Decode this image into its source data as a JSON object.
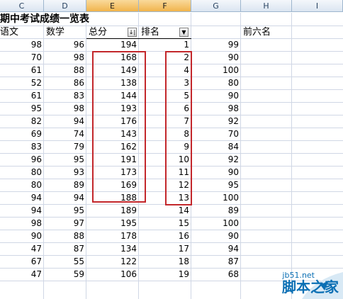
{
  "columns": [
    "C",
    "D",
    "E",
    "F",
    "G",
    "H",
    "I"
  ],
  "title": "期中考试成绩一览表",
  "headers": {
    "chinese": "语文",
    "math": "数学",
    "total": "总分",
    "rank": "排名",
    "top6": "前六名",
    "sort_indicator": "↓|",
    "dropdown_arrow": "▼"
  },
  "rows": [
    {
      "c": "98",
      "d": "96",
      "e": "194",
      "f": "1",
      "g": "99"
    },
    {
      "c": "70",
      "d": "98",
      "e": "168",
      "f": "2",
      "g": "90"
    },
    {
      "c": "61",
      "d": "88",
      "e": "149",
      "f": "4",
      "g": "100"
    },
    {
      "c": "52",
      "d": "86",
      "e": "138",
      "f": "3",
      "g": "80"
    },
    {
      "c": "61",
      "d": "83",
      "e": "144",
      "f": "5",
      "g": "90"
    },
    {
      "c": "95",
      "d": "98",
      "e": "193",
      "f": "6",
      "g": "98"
    },
    {
      "c": "82",
      "d": "94",
      "e": "176",
      "f": "7",
      "g": "92"
    },
    {
      "c": "69",
      "d": "74",
      "e": "143",
      "f": "8",
      "g": "70"
    },
    {
      "c": "83",
      "d": "79",
      "e": "162",
      "f": "9",
      "g": "84"
    },
    {
      "c": "96",
      "d": "95",
      "e": "191",
      "f": "10",
      "g": "92"
    },
    {
      "c": "80",
      "d": "93",
      "e": "173",
      "f": "11",
      "g": "90"
    },
    {
      "c": "80",
      "d": "89",
      "e": "169",
      "f": "12",
      "g": "95"
    },
    {
      "c": "94",
      "d": "94",
      "e": "188",
      "f": "13",
      "g": "100"
    },
    {
      "c": "94",
      "d": "95",
      "e": "189",
      "f": "14",
      "g": "89"
    },
    {
      "c": "98",
      "d": "97",
      "e": "195",
      "f": "15",
      "g": "100"
    },
    {
      "c": "90",
      "d": "88",
      "e": "178",
      "f": "16",
      "g": "90"
    },
    {
      "c": "47",
      "d": "87",
      "e": "134",
      "f": "17",
      "g": "94"
    },
    {
      "c": "67",
      "d": "55",
      "e": "122",
      "f": "18",
      "g": "87"
    },
    {
      "c": "47",
      "d": "59",
      "e": "106",
      "f": "19",
      "g": "68"
    }
  ],
  "watermark": {
    "site": "jb51.net",
    "name": "脚本之家"
  },
  "colors": {
    "highlight": "#c3272b",
    "header_selected": "#f1b44c",
    "gridline": "#d0d7e5",
    "watermark": "#0a6fb4"
  }
}
